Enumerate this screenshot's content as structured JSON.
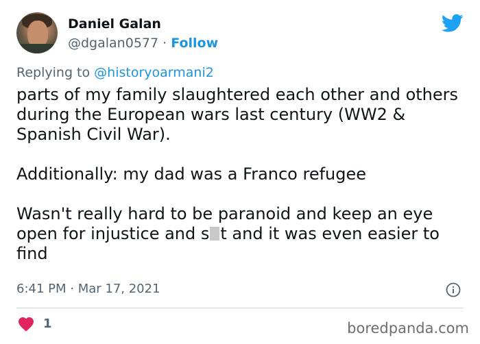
{
  "tweet": {
    "author_name": "Daniel Galan",
    "author_handle": "@dgalan0577",
    "separator": "·",
    "follow_label": "Follow",
    "replying_prefix": "Replying to",
    "replying_to": "@historyoarmani2",
    "paragraph_1": "parts of my family slaughtered each other and others during the European wars last century (WW2 & Spanish Civil War).",
    "paragraph_2": "Additionally: my dad was a Franco refugee",
    "paragraph_3_part1": "Wasn't really hard to be paranoid and keep an eye open for injustice and s",
    "paragraph_3_part2": "t and it was even easier to find",
    "timestamp": "6:41 PM · Mar 17, 2021",
    "like_count": "1"
  },
  "icons": {
    "brand": "twitter-bird-icon",
    "info": "info-icon",
    "like": "heart-icon"
  },
  "colors": {
    "twitter_blue": "#1da1f2",
    "link_blue": "#1b95e0",
    "like_pink": "#e0245e",
    "muted_text": "#536471"
  },
  "watermark": "boredpanda.com"
}
